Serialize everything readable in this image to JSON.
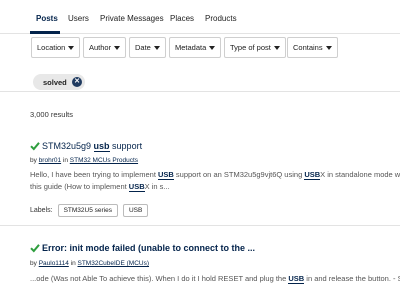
{
  "tabs": [
    {
      "label": "Posts",
      "active": true
    },
    {
      "label": "Users"
    },
    {
      "label": "Private Messages"
    },
    {
      "label": "Places"
    },
    {
      "label": "Products"
    }
  ],
  "filters": [
    "Location",
    "Author",
    "Date",
    "Metadata",
    "Type of post",
    "Contains"
  ],
  "active_filter": {
    "label": "solved",
    "remove_icon": "close-circle-icon"
  },
  "results_count": "3,000 results",
  "posts": [
    {
      "title_pre": "STM32u5g9 ",
      "title_hl": "usb",
      "title_post": " support",
      "by": "by",
      "author": "brohr01",
      "in": "in",
      "place": "STM32 MCUs Products",
      "excerpt_1_a": "Hello, I have been trying to implement ",
      "excerpt_1_hl1": "USB",
      "excerpt_1_b": " support on an STM32u5g9vjt6Q using ",
      "excerpt_1_hl2": "USB",
      "excerpt_1_c": "X in standalone mode without su",
      "excerpt_2_a": "this guide (How to implement ",
      "excerpt_2_hl": "USB",
      "excerpt_2_b": "X in s...",
      "labels_title": "Labels:",
      "labels": [
        "STM32U5 series",
        "USB"
      ]
    },
    {
      "title": "Error: init mode failed (unable to connect to the ...",
      "by": "by",
      "author": "Paulo1114",
      "in": "in",
      "place": "STM32CubeIDE (MCUs)",
      "excerpt_a": "...ode (Was not Able To achieve this). When I do it I hold RESET and plug the ",
      "excerpt_hl": "USB",
      "excerpt_b": " in and release the button. - STM32 U"
    }
  ],
  "colors": {
    "accent": "#03234b",
    "check": "#2e9e3e"
  }
}
